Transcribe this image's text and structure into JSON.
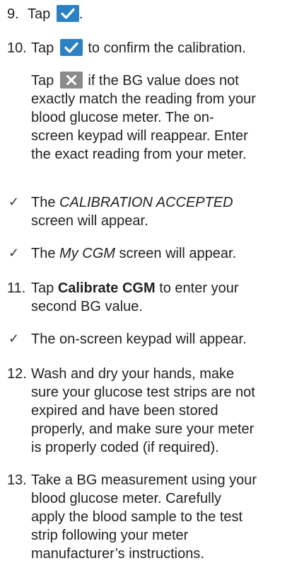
{
  "colors": {
    "check_button_bg": "#2a82c4",
    "x_button_bg": "#8a8a8a",
    "text": "#222222"
  },
  "icons": {
    "check_button": "checkmark-button-icon",
    "x_button": "x-button-icon",
    "bullet": "checkmark-bullet-icon"
  },
  "bullet_mark": "✓",
  "step9": {
    "number": "9.",
    "text_before": "Tap",
    "text_after": "."
  },
  "step10": {
    "number": "10.",
    "text_before": "Tap",
    "text_after": "to confirm the calibration.",
    "sub_line1_before": "Tap",
    "sub_line1_after": "if the BG value does not",
    "sub_line2": "exactly match the reading from your",
    "sub_line3": "blood glucose meter. The on-",
    "sub_line4": "screen keypad will reappear. Enter",
    "sub_line5": "the exact reading from your meter."
  },
  "result1": {
    "before": "The",
    "emph": "CALIBRATION ACCEPTED",
    "line2": "screen will appear."
  },
  "result2": {
    "before": "The",
    "emph": "My CGM",
    "after": "screen will appear."
  },
  "step11": {
    "number": "11.",
    "before": "Tap",
    "bold": "Calibrate CGM",
    "after": "to enter your",
    "line2": "second BG value."
  },
  "result3": {
    "text": "The on-screen keypad will appear."
  },
  "step12": {
    "number": "12.",
    "line1": "Wash and dry your hands, make",
    "line2": "sure your glucose test strips are not",
    "line3": "expired and have been stored",
    "line4": "properly, and make sure your meter",
    "line5": "is properly coded (if required)."
  },
  "step13": {
    "number": "13.",
    "line1": "Take a BG measurement using your",
    "line2": "blood glucose meter. Carefully",
    "line3": "apply the blood sample to the test",
    "line4": "strip following your meter",
    "line5": "manufacturer’s instructions."
  }
}
